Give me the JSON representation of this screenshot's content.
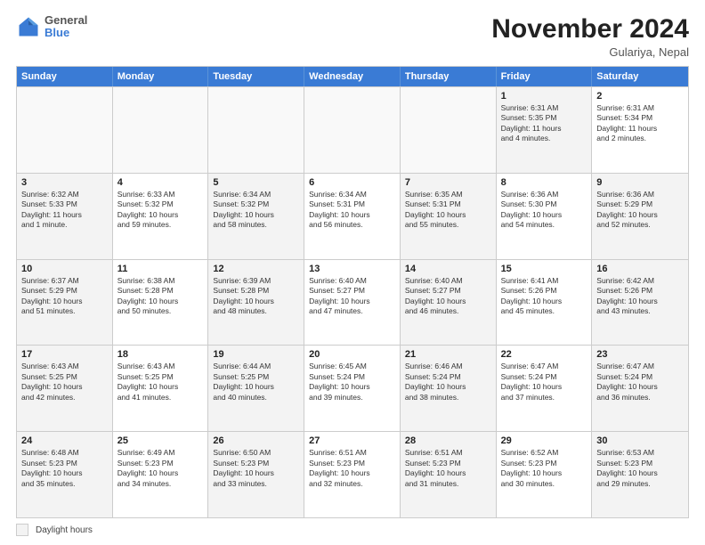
{
  "logo": {
    "line1": "General",
    "line2": "Blue"
  },
  "title": "November 2024",
  "subtitle": "Gulariya, Nepal",
  "header_days": [
    "Sunday",
    "Monday",
    "Tuesday",
    "Wednesday",
    "Thursday",
    "Friday",
    "Saturday"
  ],
  "legend_label": "Daylight hours",
  "rows": [
    [
      {
        "day": "",
        "info": "",
        "empty": true
      },
      {
        "day": "",
        "info": "",
        "empty": true
      },
      {
        "day": "",
        "info": "",
        "empty": true
      },
      {
        "day": "",
        "info": "",
        "empty": true
      },
      {
        "day": "",
        "info": "",
        "empty": true
      },
      {
        "day": "1",
        "info": "Sunrise: 6:31 AM\nSunset: 5:35 PM\nDaylight: 11 hours\nand 4 minutes.",
        "shaded": true
      },
      {
        "day": "2",
        "info": "Sunrise: 6:31 AM\nSunset: 5:34 PM\nDaylight: 11 hours\nand 2 minutes.",
        "shaded": false
      }
    ],
    [
      {
        "day": "3",
        "info": "Sunrise: 6:32 AM\nSunset: 5:33 PM\nDaylight: 11 hours\nand 1 minute.",
        "shaded": true
      },
      {
        "day": "4",
        "info": "Sunrise: 6:33 AM\nSunset: 5:32 PM\nDaylight: 10 hours\nand 59 minutes.",
        "shaded": false
      },
      {
        "day": "5",
        "info": "Sunrise: 6:34 AM\nSunset: 5:32 PM\nDaylight: 10 hours\nand 58 minutes.",
        "shaded": true
      },
      {
        "day": "6",
        "info": "Sunrise: 6:34 AM\nSunset: 5:31 PM\nDaylight: 10 hours\nand 56 minutes.",
        "shaded": false
      },
      {
        "day": "7",
        "info": "Sunrise: 6:35 AM\nSunset: 5:31 PM\nDaylight: 10 hours\nand 55 minutes.",
        "shaded": true
      },
      {
        "day": "8",
        "info": "Sunrise: 6:36 AM\nSunset: 5:30 PM\nDaylight: 10 hours\nand 54 minutes.",
        "shaded": false
      },
      {
        "day": "9",
        "info": "Sunrise: 6:36 AM\nSunset: 5:29 PM\nDaylight: 10 hours\nand 52 minutes.",
        "shaded": true
      }
    ],
    [
      {
        "day": "10",
        "info": "Sunrise: 6:37 AM\nSunset: 5:29 PM\nDaylight: 10 hours\nand 51 minutes.",
        "shaded": true
      },
      {
        "day": "11",
        "info": "Sunrise: 6:38 AM\nSunset: 5:28 PM\nDaylight: 10 hours\nand 50 minutes.",
        "shaded": false
      },
      {
        "day": "12",
        "info": "Sunrise: 6:39 AM\nSunset: 5:28 PM\nDaylight: 10 hours\nand 48 minutes.",
        "shaded": true
      },
      {
        "day": "13",
        "info": "Sunrise: 6:40 AM\nSunset: 5:27 PM\nDaylight: 10 hours\nand 47 minutes.",
        "shaded": false
      },
      {
        "day": "14",
        "info": "Sunrise: 6:40 AM\nSunset: 5:27 PM\nDaylight: 10 hours\nand 46 minutes.",
        "shaded": true
      },
      {
        "day": "15",
        "info": "Sunrise: 6:41 AM\nSunset: 5:26 PM\nDaylight: 10 hours\nand 45 minutes.",
        "shaded": false
      },
      {
        "day": "16",
        "info": "Sunrise: 6:42 AM\nSunset: 5:26 PM\nDaylight: 10 hours\nand 43 minutes.",
        "shaded": true
      }
    ],
    [
      {
        "day": "17",
        "info": "Sunrise: 6:43 AM\nSunset: 5:25 PM\nDaylight: 10 hours\nand 42 minutes.",
        "shaded": true
      },
      {
        "day": "18",
        "info": "Sunrise: 6:43 AM\nSunset: 5:25 PM\nDaylight: 10 hours\nand 41 minutes.",
        "shaded": false
      },
      {
        "day": "19",
        "info": "Sunrise: 6:44 AM\nSunset: 5:25 PM\nDaylight: 10 hours\nand 40 minutes.",
        "shaded": true
      },
      {
        "day": "20",
        "info": "Sunrise: 6:45 AM\nSunset: 5:24 PM\nDaylight: 10 hours\nand 39 minutes.",
        "shaded": false
      },
      {
        "day": "21",
        "info": "Sunrise: 6:46 AM\nSunset: 5:24 PM\nDaylight: 10 hours\nand 38 minutes.",
        "shaded": true
      },
      {
        "day": "22",
        "info": "Sunrise: 6:47 AM\nSunset: 5:24 PM\nDaylight: 10 hours\nand 37 minutes.",
        "shaded": false
      },
      {
        "day": "23",
        "info": "Sunrise: 6:47 AM\nSunset: 5:24 PM\nDaylight: 10 hours\nand 36 minutes.",
        "shaded": true
      }
    ],
    [
      {
        "day": "24",
        "info": "Sunrise: 6:48 AM\nSunset: 5:23 PM\nDaylight: 10 hours\nand 35 minutes.",
        "shaded": true
      },
      {
        "day": "25",
        "info": "Sunrise: 6:49 AM\nSunset: 5:23 PM\nDaylight: 10 hours\nand 34 minutes.",
        "shaded": false
      },
      {
        "day": "26",
        "info": "Sunrise: 6:50 AM\nSunset: 5:23 PM\nDaylight: 10 hours\nand 33 minutes.",
        "shaded": true
      },
      {
        "day": "27",
        "info": "Sunrise: 6:51 AM\nSunset: 5:23 PM\nDaylight: 10 hours\nand 32 minutes.",
        "shaded": false
      },
      {
        "day": "28",
        "info": "Sunrise: 6:51 AM\nSunset: 5:23 PM\nDaylight: 10 hours\nand 31 minutes.",
        "shaded": true
      },
      {
        "day": "29",
        "info": "Sunrise: 6:52 AM\nSunset: 5:23 PM\nDaylight: 10 hours\nand 30 minutes.",
        "shaded": false
      },
      {
        "day": "30",
        "info": "Sunrise: 6:53 AM\nSunset: 5:23 PM\nDaylight: 10 hours\nand 29 minutes.",
        "shaded": true
      }
    ]
  ]
}
